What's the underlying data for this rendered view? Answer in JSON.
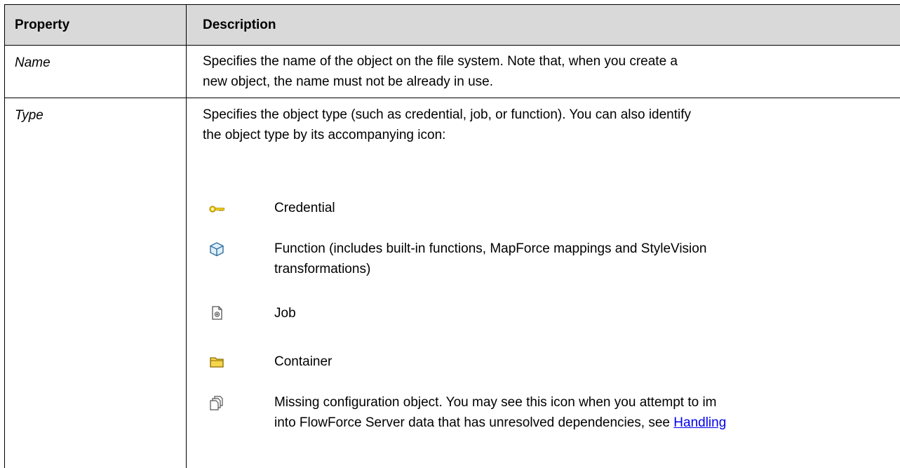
{
  "header": {
    "property": "Property",
    "description": "Description"
  },
  "rows": [
    {
      "property": "Name",
      "description_line1": "Specifies the name of the object on the file system. Note that, when you create a",
      "description_line2": "new object, the name must not be already in use."
    },
    {
      "property": "Type",
      "description_line1": "Specifies the object type (such as credential, job, or function). You can also identify",
      "description_line2": "the object type by its accompanying icon:"
    }
  ],
  "types": [
    {
      "icon": "key-icon",
      "line1": "Credential",
      "line2": ""
    },
    {
      "icon": "cube-icon",
      "line1": "Function (includes built-in functions, MapForce mappings and StyleVision",
      "line2": "transformations)"
    },
    {
      "icon": "job-icon",
      "line1": "Job",
      "line2": ""
    },
    {
      "icon": "folder-icon",
      "line1": "Container",
      "line2": ""
    },
    {
      "icon": "missing-object-icon",
      "line1": "Missing configuration object. You may see this icon when you attempt to im",
      "line2_prefix": "into FlowForce Server data that has unresolved dependencies, see ",
      "line2_link": "Handling"
    }
  ],
  "colors": {
    "header_bg": "#d9d9d9",
    "link": "#0000ee",
    "key_yellow": "#e8c20a",
    "folder_yellow": "#f5d54a"
  }
}
